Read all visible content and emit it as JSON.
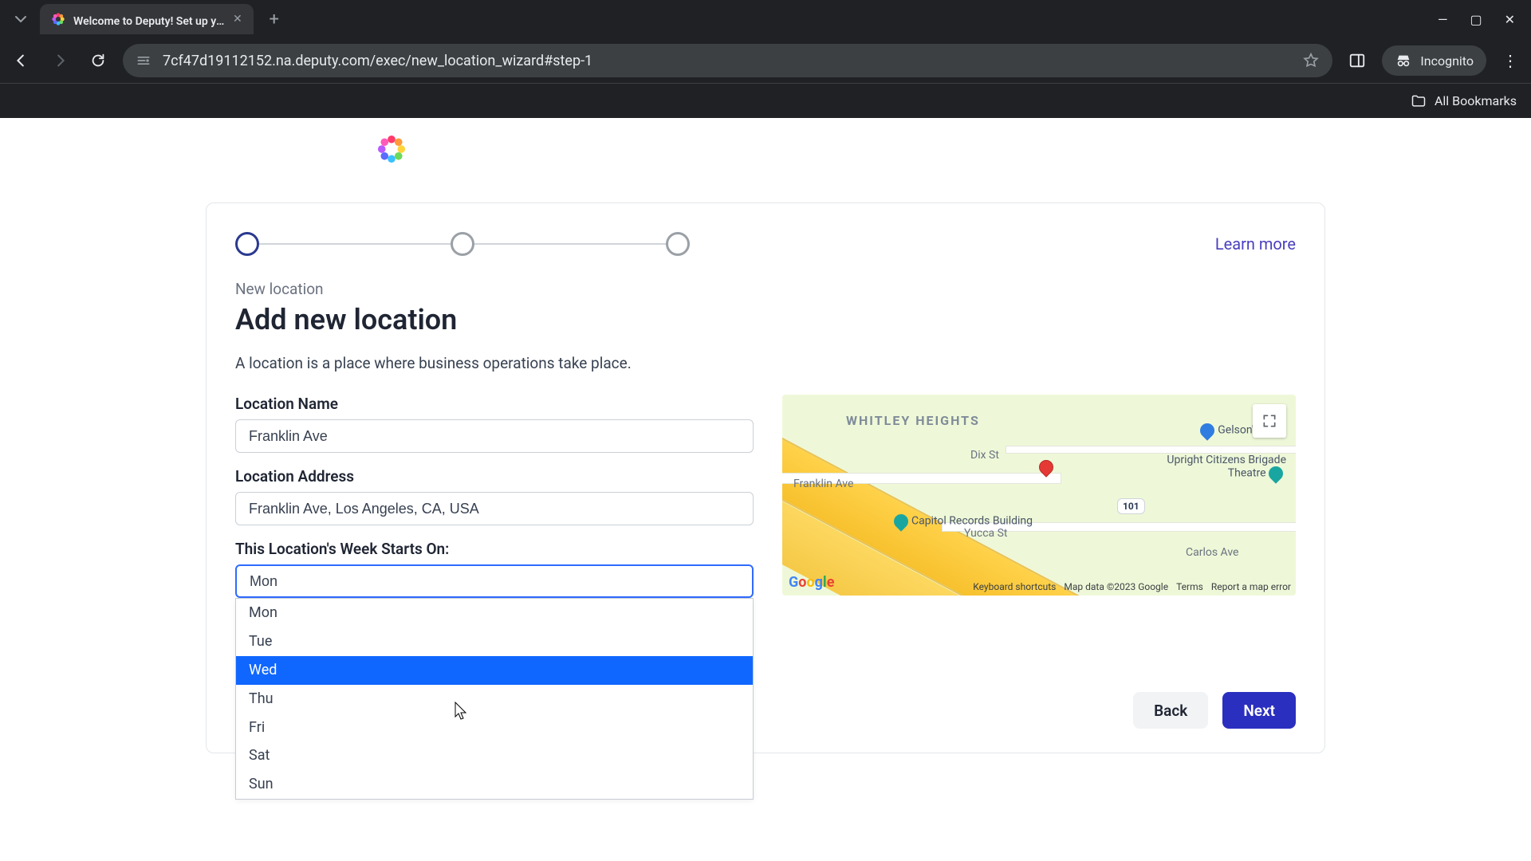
{
  "browser": {
    "tab_title": "Welcome to Deputy! Set up yo…",
    "url": "7cf47d19112152.na.deputy.com/exec/new_location_wizard#step-1",
    "incognito_label": "Incognito",
    "all_bookmarks": "All Bookmarks"
  },
  "wizard": {
    "learn_more": "Learn more",
    "subtitle": "New location",
    "title": "Add new location",
    "description": "A location is a place where business operations take place.",
    "labels": {
      "name": "Location Name",
      "address": "Location Address",
      "week_start": "This Location's Week Starts On:"
    },
    "values": {
      "name": "Franklin Ave",
      "address": "Franklin Ave, Los Angeles, CA, USA",
      "week_start_selected": "Mon"
    },
    "week_options": [
      "Mon",
      "Tue",
      "Wed",
      "Thu",
      "Fri",
      "Sat",
      "Sun"
    ],
    "week_highlighted_index": 2,
    "buttons": {
      "back": "Back",
      "next": "Next"
    }
  },
  "map": {
    "neighborhood": "WHITLEY HEIGHTS",
    "street_franklin": "Franklin Ave",
    "street_dix": "Dix St",
    "street_yucca": "Yucca St",
    "street_carlos": "Carlos Ave",
    "poi_capitol": "Capitol Records Building",
    "poi_ucb": "Upright Citizens Brigade Theatre",
    "poi_gelsons": "Gelson's",
    "shield_101": "101",
    "footer": {
      "shortcuts": "Keyboard shortcuts",
      "data": "Map data ©2023 Google",
      "terms": "Terms",
      "report": "Report a map error"
    }
  }
}
